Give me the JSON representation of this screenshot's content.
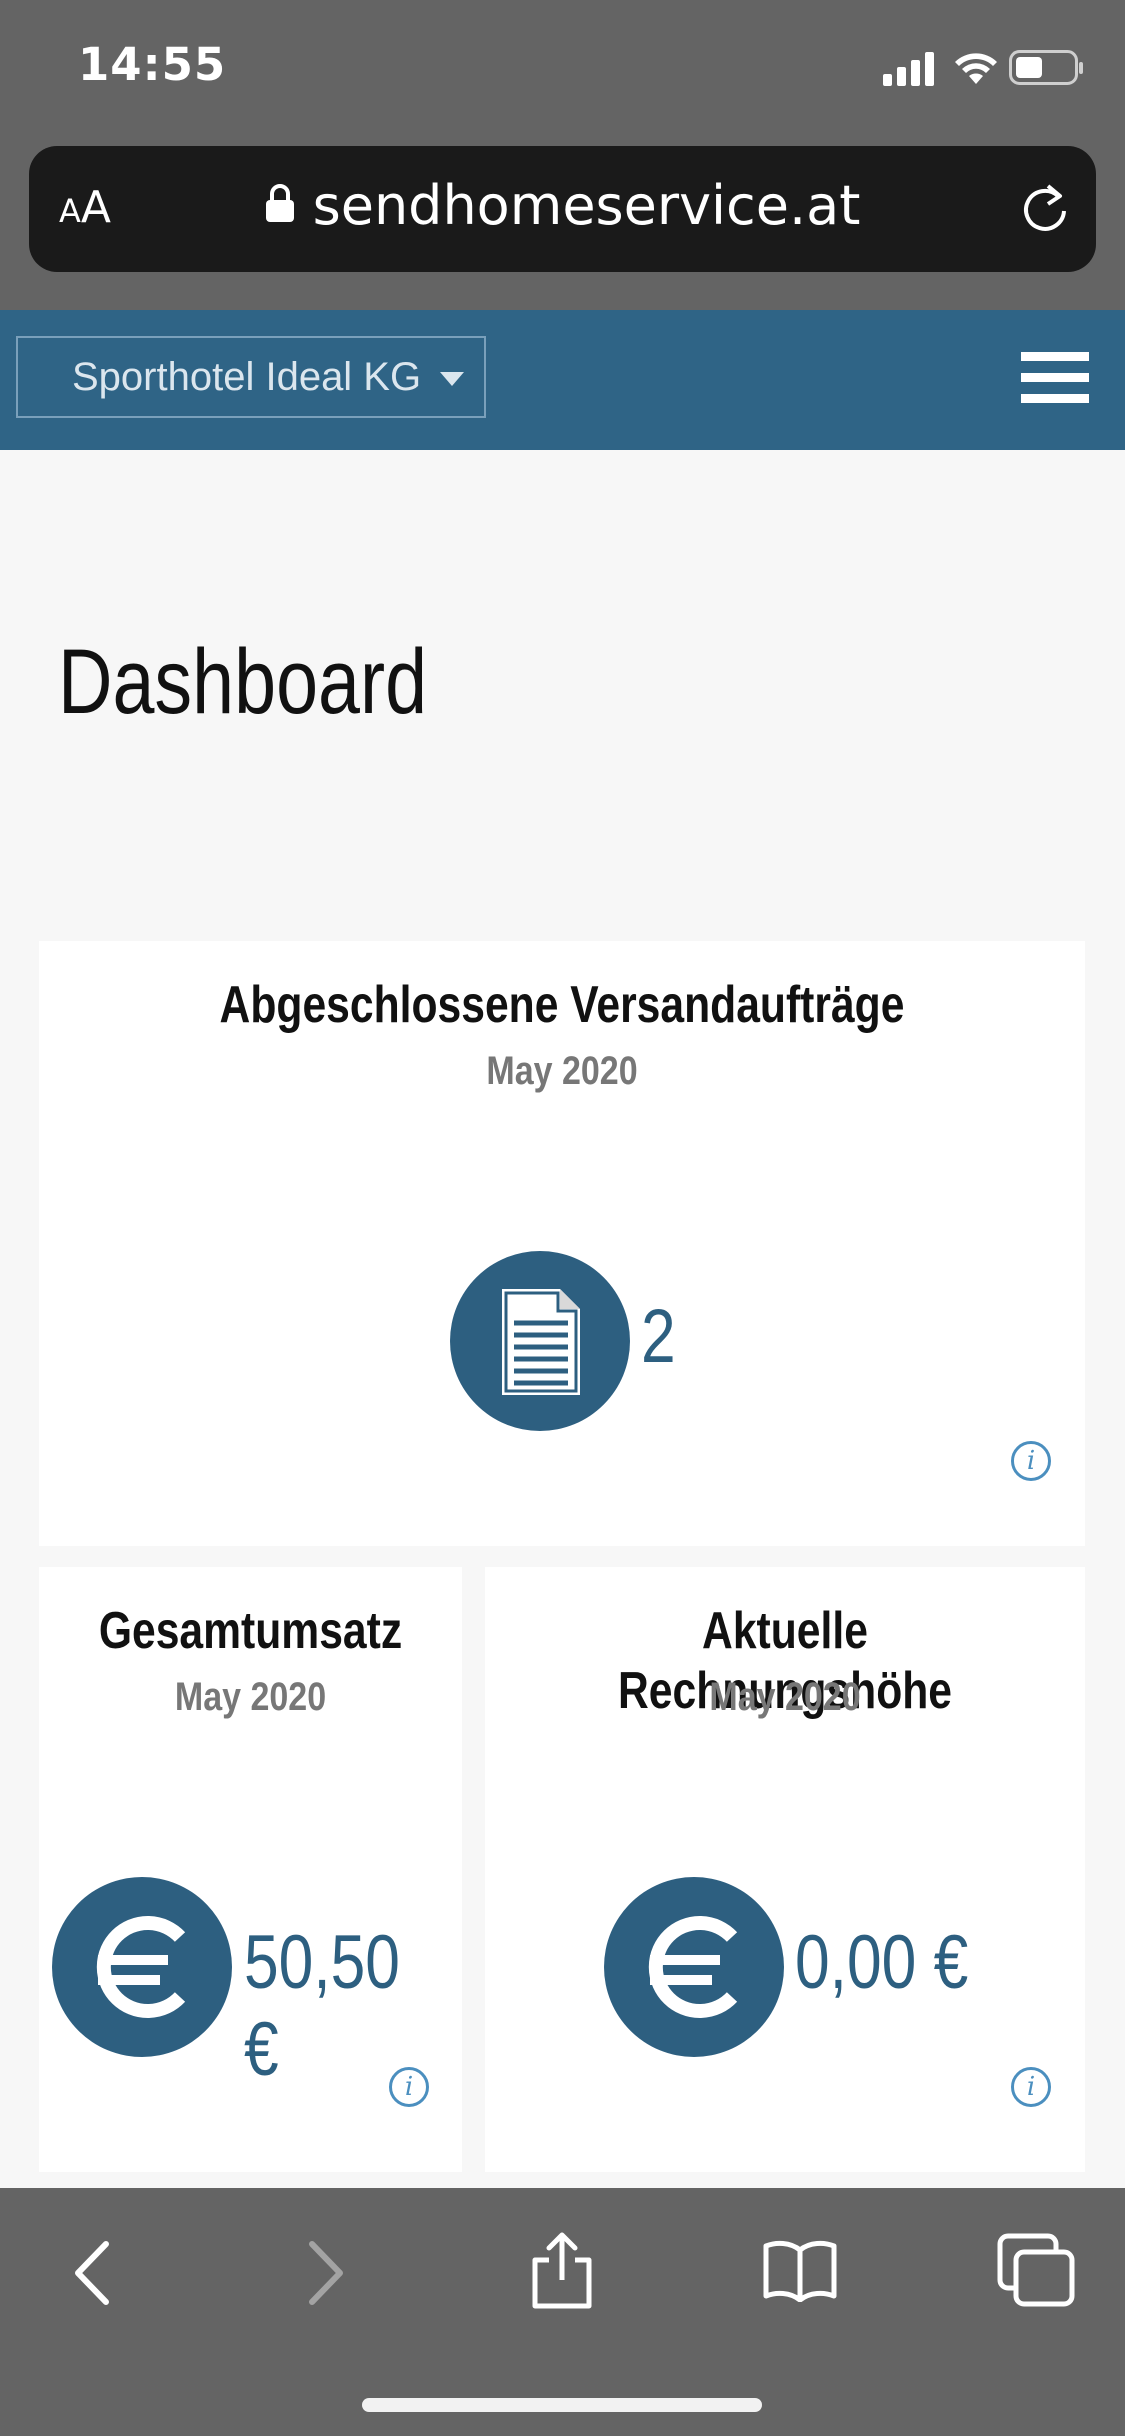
{
  "status_bar": {
    "time": "14:55"
  },
  "browser": {
    "text_size_label_small": "A",
    "text_size_label_large": "A",
    "url": "sendhomeservice.at"
  },
  "header": {
    "tenant_select": "Sporthotel Ideal KG"
  },
  "page": {
    "title": "Dashboard"
  },
  "cards": {
    "orders": {
      "title": "Abgeschlossene Versandaufträge",
      "period": "May 2020",
      "value": "2"
    },
    "revenue": {
      "title": "Gesamtumsatz",
      "period": "May 2020",
      "value": "50,50 €"
    },
    "invoice": {
      "title": "Aktuelle Rechnungshöhe",
      "period": "May 2020",
      "value": "0,00 €"
    }
  },
  "icons": {
    "info": "i",
    "euro": "€"
  },
  "colors": {
    "brand": "#2f6486",
    "accent": "#2d5f80",
    "info": "#4b8fbf"
  }
}
